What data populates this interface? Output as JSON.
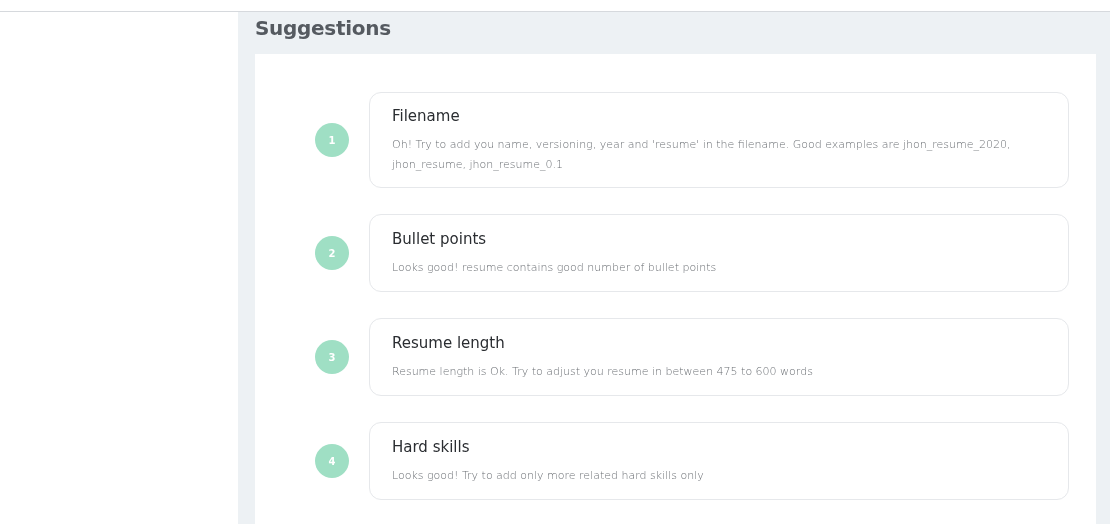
{
  "heading": "Suggestions",
  "suggestions": [
    {
      "number": "1",
      "title": "Filename",
      "text": "Oh! Try to add you name, versioning, year and 'resume' in the filename. Good examples are jhon_resume_2020, jhon_resume, jhon_resume_0.1"
    },
    {
      "number": "2",
      "title": "Bullet points",
      "text": "Looks good! resume contains good number of bullet points"
    },
    {
      "number": "3",
      "title": "Resume length",
      "text": "Resume length is Ok. Try to adjust you resume in between 475 to 600 words"
    },
    {
      "number": "4",
      "title": "Hard skills",
      "text": "Looks good! Try to add only more related hard skills only"
    }
  ]
}
